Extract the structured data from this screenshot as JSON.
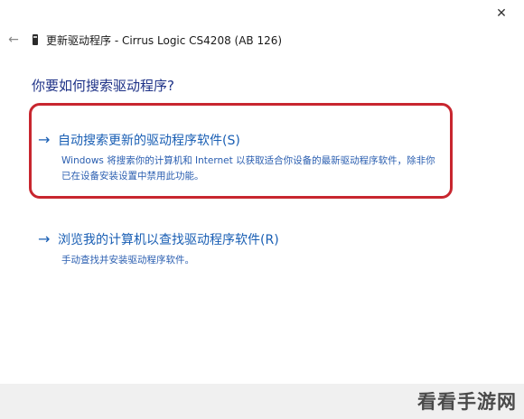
{
  "window": {
    "close_glyph": "✕",
    "back_glyph": "←",
    "title": "更新驱动程序 - Cirrus Logic CS4208 (AB 126)"
  },
  "main": {
    "question": "你要如何搜索驱动程序?",
    "options": [
      {
        "arrow": "→",
        "title": "自动搜索更新的驱动程序软件(S)",
        "description": "Windows 将搜索你的计算机和 Internet 以获取适合你设备的最新驱动程序软件，除非你已在设备安装设置中禁用此功能。",
        "highlighted": true
      },
      {
        "arrow": "→",
        "title": "浏览我的计算机以查找驱动程序软件(R)",
        "description": "手动查找并安装驱动程序软件。",
        "highlighted": false
      }
    ]
  },
  "watermark": "看看手游网",
  "colors": {
    "heading": "#1e3287",
    "link": "#1a5fb4",
    "highlight_border": "#c8262f"
  }
}
